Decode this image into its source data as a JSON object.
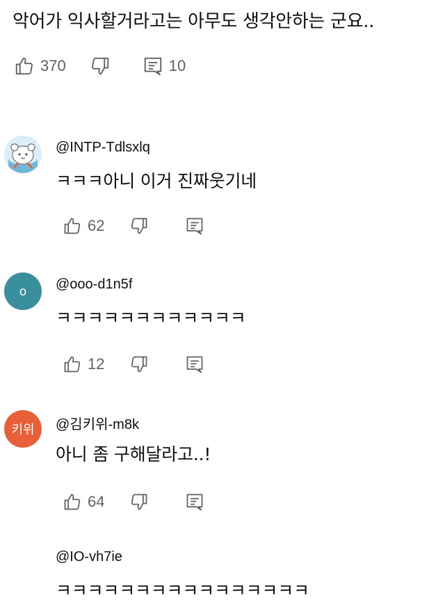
{
  "post": {
    "text": "악어가 익사할거라고는 아무도 생각안하는 군요..",
    "likes": "370",
    "replies": "10"
  },
  "comments": [
    {
      "handle": "@INTP-Tdlsxlq",
      "text": "ㅋㅋㅋ아니 이거 진짜웃기네",
      "likes": "62",
      "avatar_type": "mascot-icon",
      "avatar_color": "#6fb7d9"
    },
    {
      "handle": "@ooo-d1n5f",
      "text": "ㅋㅋㅋㅋㅋㅋㅋㅋㅋㅋㅋㅋ",
      "likes": "12",
      "avatar_letter": "o",
      "avatar_color": "#3a8f9e"
    },
    {
      "handle": "@김키위-m8k",
      "text": "아니 좀 구해달라고..!",
      "likes": "64",
      "avatar_letter": "키위",
      "avatar_color": "#e8603a"
    },
    {
      "handle": "@IO-vh7ie",
      "text": "ㅋㅋㅋㅋㅋㅋㅋㅋㅋㅋㅋㅋㅋㅋㅋㅋ"
    }
  ],
  "colors": {
    "text": "#0f0f0f",
    "icon": "#606060",
    "background": "#ffffff"
  }
}
